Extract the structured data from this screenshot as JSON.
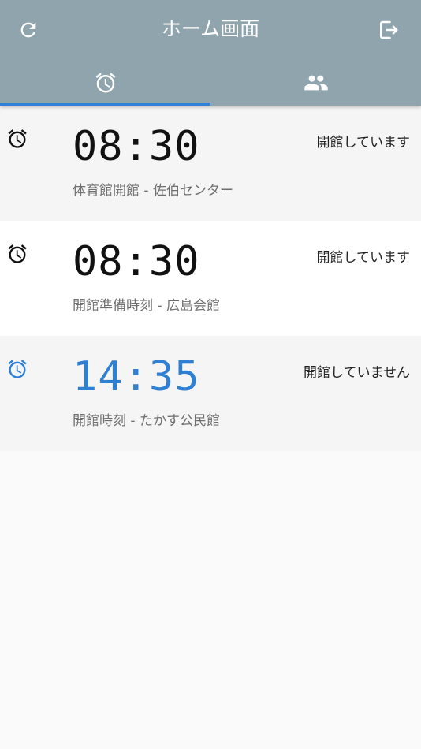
{
  "app": {
    "title": "ホーム画面",
    "icons": {
      "refresh": "refresh-icon",
      "logout": "logout-icon"
    }
  },
  "tabs": [
    {
      "icon": "alarm-clock-icon",
      "selected": true
    },
    {
      "icon": "people-icon",
      "selected": false
    }
  ],
  "colors": {
    "appbar": "#90a4ae",
    "accent": "#2f80d8",
    "active_time": "#2f7fd3"
  },
  "alarms": [
    {
      "time": "08:30",
      "label": "体育館開館 - 佐伯センター",
      "status": "開館しています",
      "active": false
    },
    {
      "time": "08:30",
      "label": "開館準備時刻 - 広島会館",
      "status": "開館しています",
      "active": false
    },
    {
      "time": "14:35",
      "label": "開館時刻 - たかす公民館",
      "status": "開館していません",
      "active": true
    }
  ]
}
